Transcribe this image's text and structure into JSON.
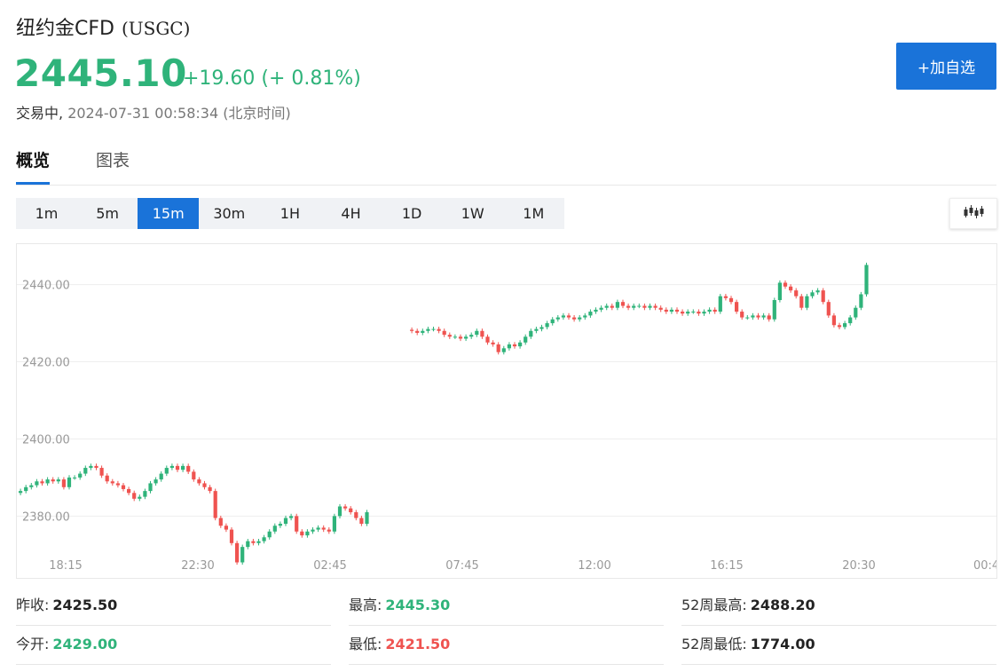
{
  "header": {
    "name": "纽约金CFD",
    "symbol": "(USGC)",
    "price": "2445.10",
    "change": "+19.60 (+ 0.81%)",
    "status": "交易中,",
    "timestamp": "2024-07-31 00:58:34 (北京时间)",
    "add_button": "+加自选"
  },
  "colors": {
    "up": "#2fb37a",
    "down": "#ef5350",
    "accent": "#1a73d9",
    "neutral": "#222222"
  },
  "tabs": [
    {
      "label": "概览",
      "active": true
    },
    {
      "label": "图表",
      "active": false
    }
  ],
  "periods": [
    {
      "label": "1m",
      "selected": false
    },
    {
      "label": "5m",
      "selected": false
    },
    {
      "label": "15m",
      "selected": true
    },
    {
      "label": "30m",
      "selected": false
    },
    {
      "label": "1H",
      "selected": false
    },
    {
      "label": "4H",
      "selected": false
    },
    {
      "label": "1D",
      "selected": false
    },
    {
      "label": "1W",
      "selected": false
    },
    {
      "label": "1M",
      "selected": false
    }
  ],
  "chart_type_icon": "candlestick-icon",
  "stats": [
    {
      "label": "昨收:",
      "value": "2425.50",
      "tone": "neutral"
    },
    {
      "label": "最高:",
      "value": "2445.30",
      "tone": "up"
    },
    {
      "label": "52周最高:",
      "value": "2488.20",
      "tone": "neutral"
    },
    {
      "label": "今开:",
      "value": "2429.00",
      "tone": "up"
    },
    {
      "label": "最低:",
      "value": "2421.50",
      "tone": "down"
    },
    {
      "label": "52周最低:",
      "value": "1774.00",
      "tone": "neutral"
    }
  ],
  "chart_data": {
    "type": "candlestick",
    "interval": "15m",
    "y_ticks": [
      "2440.00",
      "2420.00",
      "2400.00",
      "2380.00"
    ],
    "x_ticks": [
      "18:15",
      "22:30",
      "02:45",
      "07:45",
      "12:00",
      "16:15",
      "20:30",
      "00:4"
    ],
    "ylim": [
      2369.5,
      2450.5
    ],
    "grid": true,
    "segments": [
      {
        "note": "session 1",
        "closes": [
          2386.5,
          2387.5,
          2388,
          2389,
          2388.5,
          2389.5,
          2389,
          2389.5,
          2387.5,
          2390,
          2390,
          2391,
          2392.5,
          2393,
          2392.5,
          2390.5,
          2389,
          2388.5,
          2388,
          2387,
          2386,
          2384.5,
          2385,
          2386.5,
          2388.5,
          2389.5,
          2391,
          2392.5,
          2393,
          2392,
          2393,
          2391.5,
          2389.5,
          2388.5,
          2387.5,
          2386.5,
          2379.5,
          2377.5,
          2376.5,
          2373,
          2368,
          2372,
          2373.5,
          2373,
          2373.5,
          2374.5,
          2376,
          2377.5,
          2378,
          2379.5,
          2380,
          2376,
          2375,
          2376,
          2376.5,
          2377,
          2376.5,
          2376,
          2380,
          2382.5,
          2382,
          2381,
          2379.5,
          2378,
          2381
        ],
        "start_open": 2386
      },
      {
        "note": "session 2",
        "closes": [
          2428,
          2427.5,
          2428,
          2428.5,
          2428.5,
          2428,
          2427,
          2426.5,
          2426.5,
          2426,
          2426.5,
          2427,
          2428,
          2426.5,
          2425,
          2424.5,
          2422.5,
          2423.5,
          2424.5,
          2424,
          2425,
          2426.5,
          2428,
          2428.5,
          2429,
          2430,
          2431,
          2431.5,
          2432,
          2431.5,
          2431,
          2431.5,
          2432,
          2433,
          2433.5,
          2434,
          2434.5,
          2434,
          2435.5,
          2434.5,
          2434,
          2434.5,
          2434.5,
          2434,
          2434.5,
          2434,
          2433.5,
          2433,
          2433.5,
          2433,
          2432.5,
          2433,
          2433,
          2432.5,
          2433,
          2433.5,
          2433,
          2437,
          2436.5,
          2435.5,
          2433,
          2431.5,
          2431.5,
          2432,
          2431.5,
          2432,
          2431,
          2436,
          2440.5,
          2439.5,
          2438.5,
          2437,
          2434,
          2437,
          2438,
          2438.5,
          2435.5,
          2432,
          2429.5,
          2429,
          2430,
          2431.5,
          2434,
          2437.5,
          2445.1
        ],
        "start_open": 2428.3
      }
    ]
  }
}
